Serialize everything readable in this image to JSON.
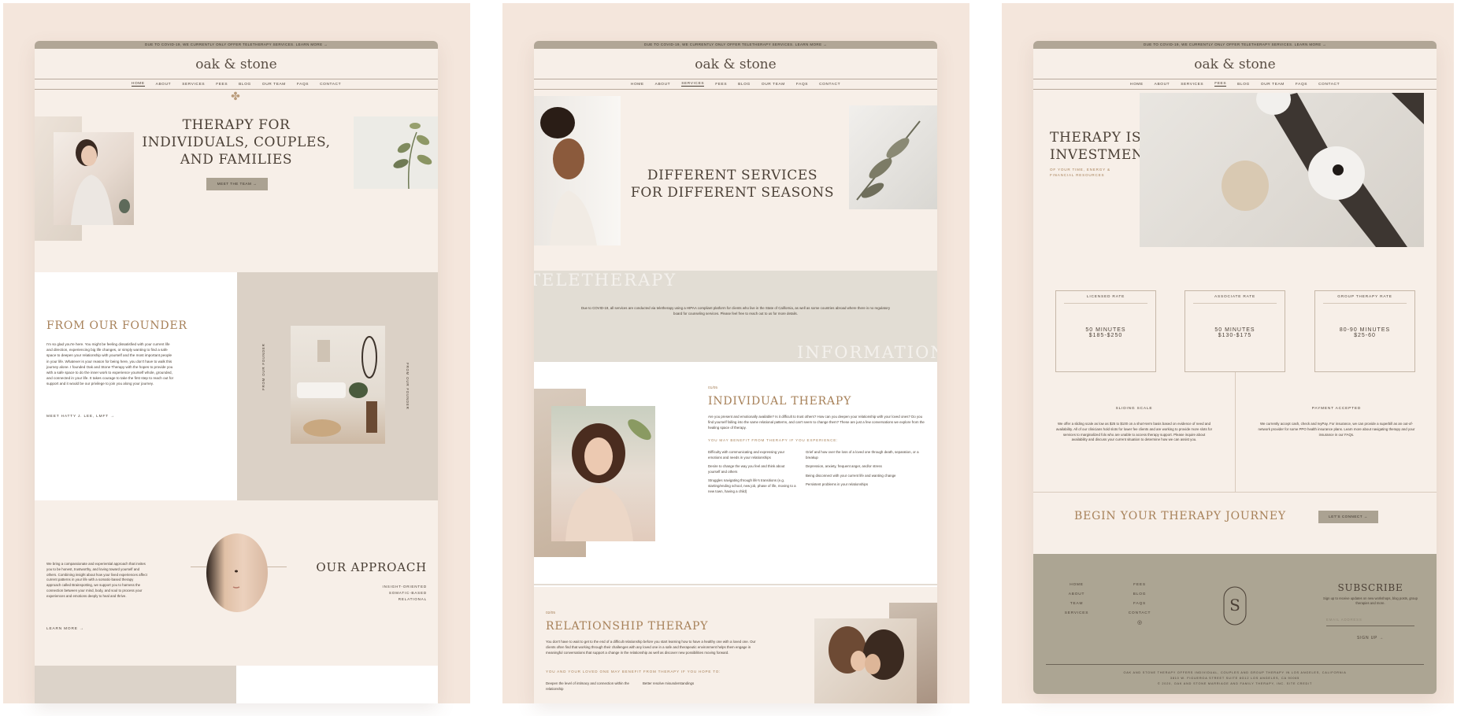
{
  "announcement": "DUE TO COVID-19, WE CURRENTLY ONLY OFFER TELETHERAPY SERVICES. LEARN MORE →",
  "logo": "oak & stone",
  "nav": [
    "HOME",
    "ABOUT",
    "SERVICES",
    "FEES",
    "BLOG",
    "OUR TEAM",
    "FAQS",
    "CONTACT"
  ],
  "colors": {
    "panel_bg": "#f4e6dc",
    "site_bg": "#f7efe8",
    "accent_gold": "#a78159",
    "button": "#aba292",
    "footer_bg": "#aca593"
  },
  "page1": {
    "hero_title": "THERAPY FOR INDIVIDUALS, COUPLES, AND FAMILIES",
    "hero_button": "MEET THE TEAM →",
    "founder_title": "FROM OUR FOUNDER",
    "founder_body": "I'm so glad you're here. You might be feeling dissatisfied with your current life and direction, experiencing big life changes, or simply wanting to find a safe space to deepen your relationship with yourself and the most important people in your life. Whatever is your reason for being here, you don't have to walk this journey alone. I founded Oak and Stone Therapy with the hopes to provide you with a safe space to do the inner work to experience yourself whole, grounded, and connected in your life. It takes courage to take the first step to reach out for support and it would be our privilege to join you along your journey.",
    "founder_link": "MEET HATTY J. LEE, LMFT →",
    "vertical_label": "FROM OUR FOUNDER",
    "approach_title": "OUR APPROACH",
    "approach_tags": [
      "INSIGHT-ORIENTED",
      "SOMATIC-BASED",
      "RELATIONAL"
    ],
    "approach_body": "We bring a compassionate and experiential approach that invites you to be honest, trustworthy, and loving toward yourself and others. Combining insight about how your lived experiences affect current patterns in your life with a somatic-based therapy approach called Brainspotting, we support you to harness the connection between your mind, body, and soul to process your experiences and emotions deeply to heal and thrive.",
    "approach_link": "LEARN MORE →"
  },
  "page2": {
    "hero_title": "DIFFERENT SERVICES FOR DIFFERENT SEASONS",
    "band_word_1": "TELETHERAPY",
    "band_word_2": "INFORMATION",
    "band_text": "Due to COVID-19, all services are conducted via teletherapy using a HIPAA compliant platform for clients who live in the State of California, as well as some countries abroad where there is no regulatory board for counseling services. Please feel free to reach out to us for more details.",
    "s1_num": "01/05",
    "s1_title": "INDIVIDUAL THERAPY",
    "s1_body": "Are you present and emotionally available? Is it difficult to trust others? How can you deepen your relationship with your loved ones? Do you find yourself falling into the same relational patterns, and can't seem to change them? These are just a few conversations we explore from the healing space of therapy.",
    "s1_sub": "YOU MAY BENEFIT FROM THERAPY IF YOU EXPERIENCE:",
    "s1_left": [
      "Difficulty with communicating and expressing your emotions and needs in your relationships",
      "Desire to change the way you feel and think about yourself and others",
      "Struggles navigating through life's transitions (e.g. starting/ending school, new job, phase of life, moving to a new town, having a child)"
    ],
    "s1_right": [
      "Grief and how over the loss of a loved one through death, separation, or a breakup",
      "Depression, anxiety, frequent anger, and/or stress",
      "Being disconnect with your current life and wanting change",
      "Persistent problems in your relationships"
    ],
    "s2_num": "02/05",
    "s2_title": "RELATIONSHIP THERAPY",
    "s2_body": "You don't have to wait to get to the end of a difficult relationship before you start learning how to have a healthy one with a loved one. Our clients often find that working through their challenges with any loved one in a safe and therapeutic environment helps them engage in meaningful conversations that support a change in the relationship as well as discover new possibilities moving forward.",
    "s2_sub": "YOU AND YOUR LOVED ONE MAY BENEFIT FROM THERAPY IF YOU HOPE TO:",
    "s2_items": [
      "Deepen the level of intimacy and connection within the relationship",
      "Better resolve misunderstandings"
    ]
  },
  "page3": {
    "hero_title": "THERAPY IS AN INVESTMENT",
    "hero_sub": "OF YOUR TIME, ENERGY & FINANCIAL RESOURCES",
    "rates": [
      {
        "label": "LICENSED RATE",
        "duration": "50 MINUTES",
        "price": "$185-$250"
      },
      {
        "label": "ASSOCIATE RATE",
        "duration": "50 MINUTES",
        "price": "$130-$175"
      },
      {
        "label": "GROUP THERAPY RATE",
        "duration": "80-90 MINUTES",
        "price": "$25-60"
      }
    ],
    "sliding_title": "SLIDING SCALE",
    "sliding_body": "We offer a sliding scale as low as $25 to $100 on a short-term basis based on evidence of need and availability. All of our clinicians hold slots for lower fee clients and are working to provide more slots for services to marginalized folx who are unable to access therapy support. Please inquire about availability and discuss your current situation to determine how we can assist you.",
    "payment_title": "PAYMENT ACCEPTED",
    "payment_body": "We currently accept cash, check and IvyPay. For insurance, we can provide a superbill as an out-of-network provider for some PPO health insurance plans. Learn more about navigating therapy and your insurance in our FAQs.",
    "cta_title": "BEGIN YOUR THERAPY JOURNEY",
    "cta_button": "LET'S CONNECT →",
    "footer_links_1": [
      "HOME",
      "ABOUT",
      "TEAM",
      "SERVICES"
    ],
    "footer_links_2": [
      "FEES",
      "BLOG",
      "FAQS",
      "CONTACT"
    ],
    "subscribe_title": "SUBSCRIBE",
    "subscribe_text": "Sign up to receive updates on new workshops, blog posts, group therapies and more.",
    "email_placeholder": "EMAIL ADDRESS",
    "signup": "SIGN UP →",
    "footer_line_1": "OAK AND STONE THERAPY OFFERS INDIVIDUAL, COUPLES AND GROUP THERAPY IN LOS ANGELES, CALIFORNIA",
    "footer_line_2": "3810 W. FIGUEROA STREET SUITE 8G12 LOS ANGELES, CA 90065",
    "footer_line_3": "© 2020, OAK AND STONE MARRIAGE AND FAMILY THERAPY, INC. SITE CREDIT"
  }
}
